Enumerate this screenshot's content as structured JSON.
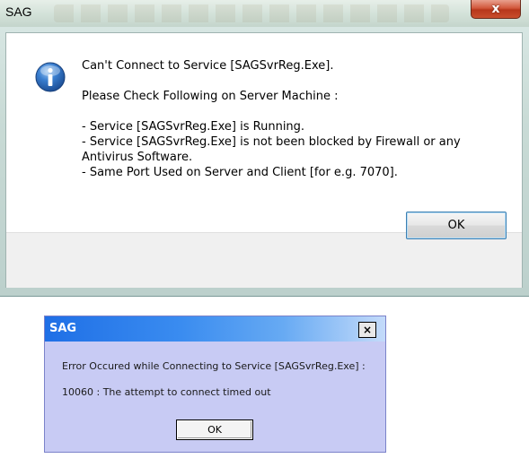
{
  "dialog1": {
    "title": "SAG",
    "close_glyph": "x",
    "icon": "information-icon",
    "lines": [
      "Can't Connect to Service [SAGSvrReg.Exe].",
      "",
      "Please Check Following on Server Machine :",
      "",
      " - Service [SAGSvrReg.Exe] is Running.",
      " - Service [SAGSvrReg.Exe] is not been blocked by Firewall or any",
      "Antivirus Software.",
      " - Same Port Used on Server and Client [for e.g. 7070]."
    ],
    "ok_label": "OK"
  },
  "dialog2": {
    "title": "SAG",
    "close_glyph": "×",
    "message1": "Error Occured while Connecting to Service [SAGSvrReg.Exe] :",
    "message2": "10060 : The attempt to connect timed out",
    "ok_label": "OK"
  },
  "colors": {
    "win7_close_red": "#c94e2d",
    "xp_title_blue": "#1f6fe6",
    "dialog2_body": "#c8cbf4",
    "info_icon_blue": "#2f6fc2"
  }
}
